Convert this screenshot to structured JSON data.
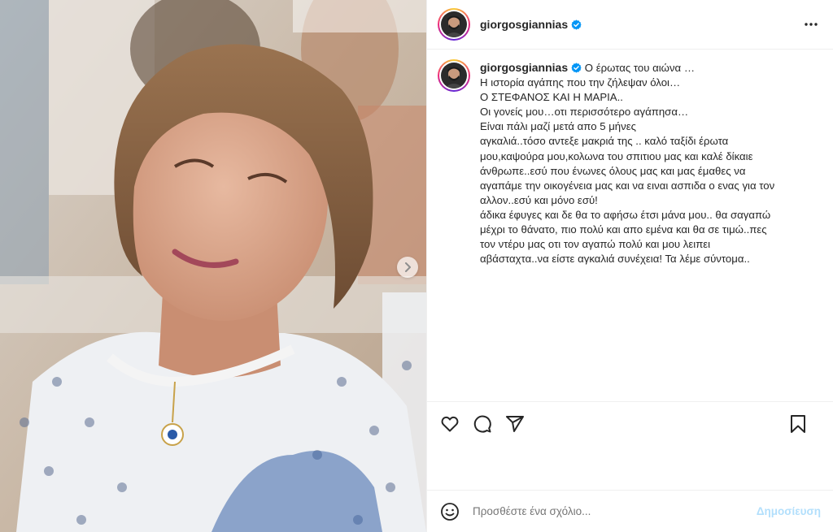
{
  "header": {
    "username": "giorgosgiannias",
    "verified_icon": "verified-badge-icon",
    "more_icon": "more-options-icon"
  },
  "caption": {
    "username": "giorgosgiannias",
    "text": "Ο έρωτας του αιώνα …\nΗ ιστορία αγάπης που την ζήλεψαν όλοι…\nΟ ΣΤΕΦΑΝΟΣ ΚΑΙ Η ΜΑΡΙΑ..\nΟι γονείς μου…οτι περισσότερο αγάπησα…\nΕίναι πάλι μαζί μετά απο 5 μήνες\nαγκαλιά..τόσο αντεξε μακριά της .. καλό ταξίδι έρωτα\nμου,καψούρα μου,κολωνα του σπιτιου μας και καλέ δίκαιε\nάνθρωπε..εσύ που ένωνες όλους μας και μας έμαθες να\nαγαπάμε την οικογένεια μας και να ειναι ασπιδα ο ενας για τον\nαλλον..εσύ και μόνο εσύ!\nάδικα έφυγες και δε θα το αφήσω έτσι μάνα μου.. θα σαγαπώ\nμέχρι το θάνατο, πιο πολύ και απο εμένα και θα σε τιμώ..πες\nτον ντέρυ μας οτι τον αγαπώ πολύ και μου λειπει\nαβάσταχτα..να είστε αγκαλιά συνέχεια! Τα λέμε σύντομα.."
  },
  "actions": {
    "like_icon": "heart-icon",
    "comment_icon": "comment-icon",
    "share_icon": "share-icon",
    "save_icon": "bookmark-icon"
  },
  "comment_bar": {
    "emoji_icon": "emoji-icon",
    "placeholder": "Προσθέστε ένα σχόλιο...",
    "post_label": "Δημοσίευση"
  },
  "media": {
    "next_icon": "chevron-right-icon"
  },
  "colors": {
    "text": "#262626",
    "muted": "#737373",
    "post_button_disabled": "#b2dffc",
    "verified_blue": "#0095f6",
    "divider": "#efefef"
  }
}
